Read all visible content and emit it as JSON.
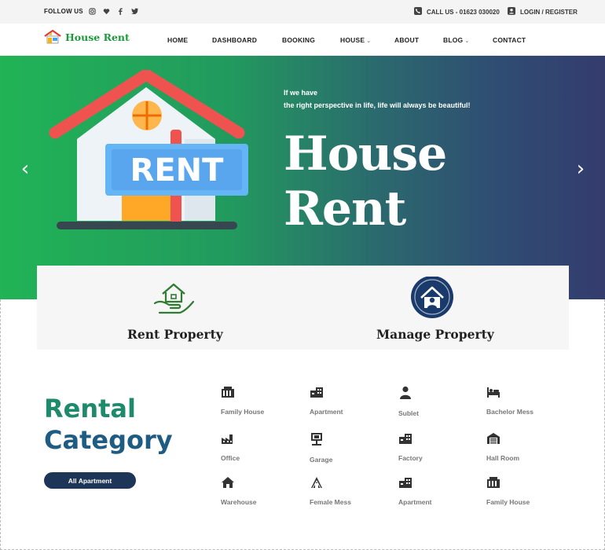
{
  "topbar": {
    "follow_label": "FOLLOW US",
    "social": [
      "instagram-icon",
      "heart-icon",
      "facebook-icon",
      "twitter-icon"
    ],
    "call_label": "CALL US - 01623 030020",
    "login_label": "LOGIN / REGISTER"
  },
  "nav": {
    "logo_text": "House Rent",
    "items": [
      {
        "label": "HOME",
        "has_caret": false
      },
      {
        "label": "DASHBOARD",
        "has_caret": false
      },
      {
        "label": "BOOKING",
        "has_caret": false
      },
      {
        "label": "HOUSE",
        "has_caret": true
      },
      {
        "label": "ABOUT",
        "has_caret": false
      },
      {
        "label": "BLOG",
        "has_caret": true
      },
      {
        "label": "CONTACT",
        "has_caret": false
      }
    ],
    "caret_glyph": "⌄"
  },
  "hero": {
    "sign_text": "RENT",
    "tagline_1": "If we have",
    "tagline_2": "the right perspective in life, life will always be beautiful!",
    "title_1": "House",
    "title_2": "Rent",
    "prev_glyph": "‹",
    "next_glyph": "›"
  },
  "services": [
    {
      "title": "Rent Property",
      "icon": "hand-house-icon"
    },
    {
      "title": "Manage Property",
      "icon": "house-user-icon"
    }
  ],
  "rental": {
    "title_1": "Rental",
    "title_2": "Category",
    "button": "All Apartment",
    "categories": [
      {
        "label": "Family House",
        "icon": "building-icon"
      },
      {
        "label": "Apartment",
        "icon": "apartment-icon"
      },
      {
        "label": "Sublet",
        "icon": "person-icon"
      },
      {
        "label": "Bachelor Mess",
        "icon": "bed-icon"
      },
      {
        "label": "Office",
        "icon": "factory-icon"
      },
      {
        "label": "Garage",
        "icon": "garage-icon"
      },
      {
        "label": "Factory",
        "icon": "apartment-icon"
      },
      {
        "label": "Hall Room",
        "icon": "hall-icon"
      },
      {
        "label": "Warehouse",
        "icon": "home-icon"
      },
      {
        "label": "Female Mess",
        "icon": "female-icon"
      },
      {
        "label": "Apartment",
        "icon": "apartment-icon"
      },
      {
        "label": "Family House",
        "icon": "building-icon"
      }
    ]
  },
  "colors": {
    "brand_green": "#1d9b3c",
    "button_navy": "#1d3557",
    "hero_left": "#21b356",
    "hero_right": "#343c6e"
  }
}
